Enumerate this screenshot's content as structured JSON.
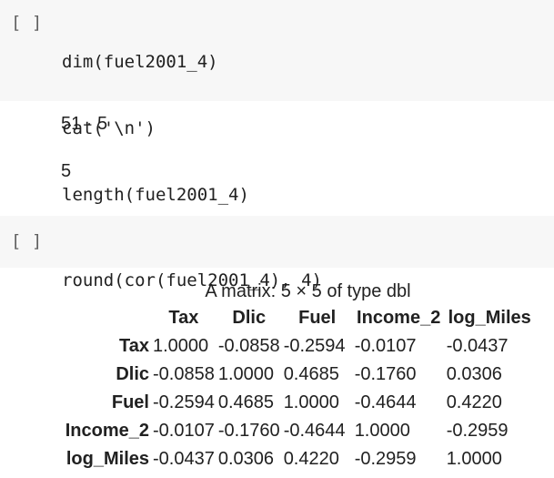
{
  "cells": [
    {
      "run_label": "[ ]",
      "code_lines": [
        "dim(fuel2001_4)",
        "cat('\\n')",
        "length(fuel2001_4)"
      ],
      "outputs": [
        "51 · 5",
        "5"
      ]
    },
    {
      "run_label": "[ ]",
      "code_line": "round(cor(fuel2001_4), 4)",
      "matrix": {
        "caption": "A matrix: 5 × 5 of type dbl",
        "columns": [
          "Tax",
          "Dlic",
          "Fuel",
          "Income_2",
          "log_Miles"
        ],
        "rows": [
          {
            "label": "Tax",
            "values": [
              "1.0000",
              "-0.0858",
              "-0.2594",
              "-0.0107",
              "-0.0437"
            ]
          },
          {
            "label": "Dlic",
            "values": [
              "-0.0858",
              "1.0000",
              "0.4685",
              "-0.1760",
              "0.0306"
            ]
          },
          {
            "label": "Fuel",
            "values": [
              "-0.2594",
              "0.4685",
              "1.0000",
              "-0.4644",
              "0.4220"
            ]
          },
          {
            "label": "Income_2",
            "values": [
              "-0.0107",
              "-0.1760",
              "-0.4644",
              "1.0000",
              "-0.2959"
            ]
          },
          {
            "label": "log_Miles",
            "values": [
              "-0.0437",
              "0.0306",
              "0.4220",
              "-0.2959",
              "1.0000"
            ]
          }
        ]
      }
    }
  ]
}
